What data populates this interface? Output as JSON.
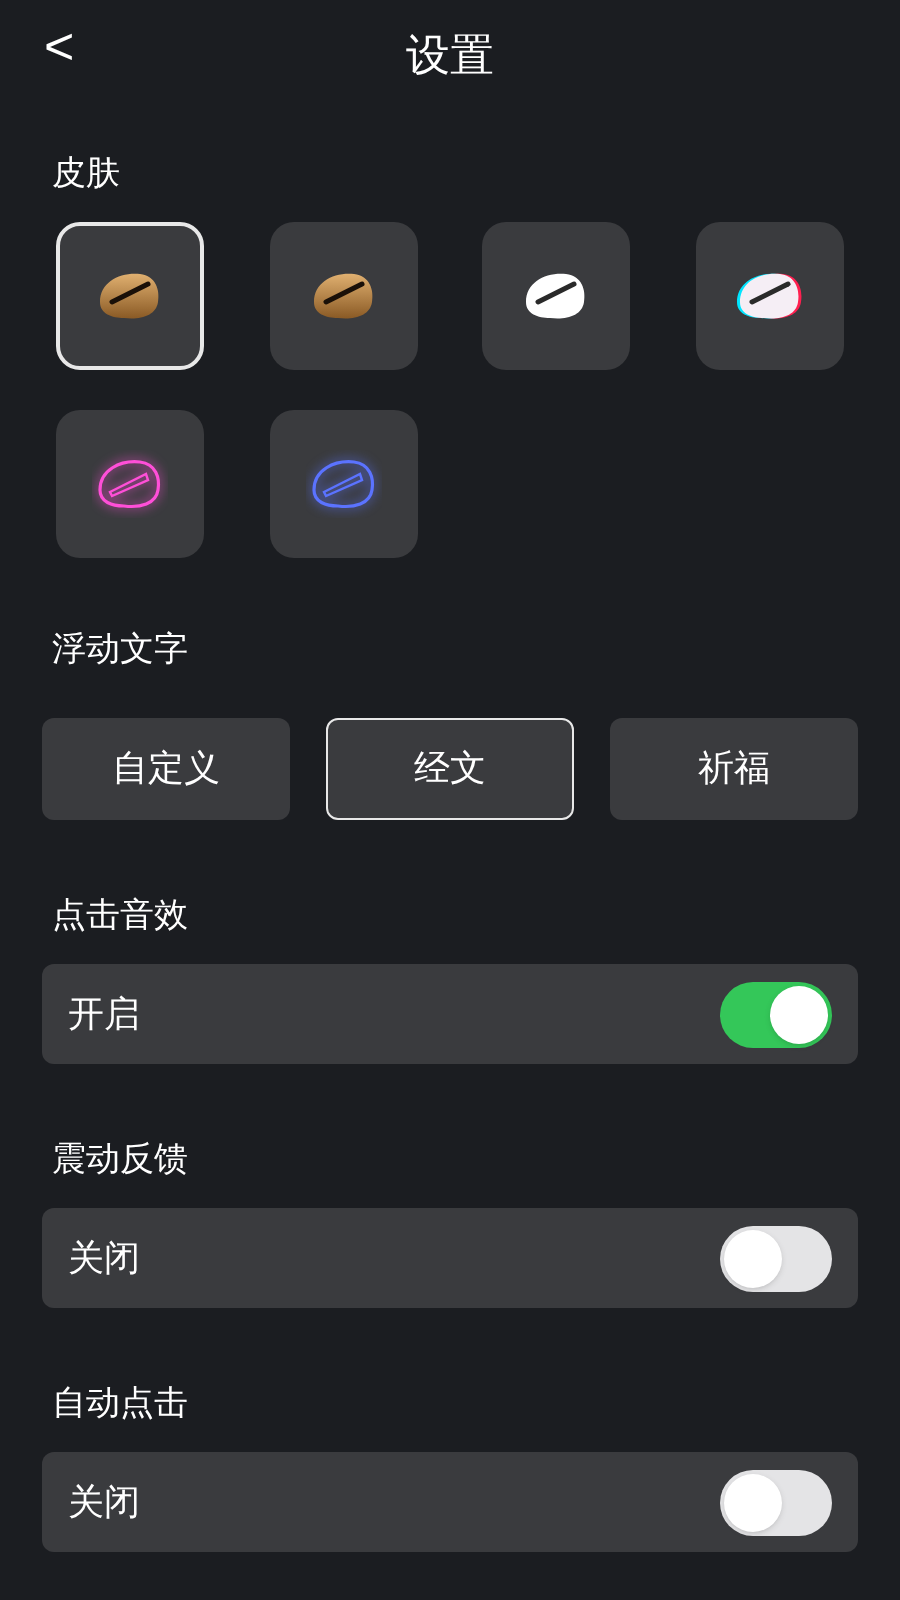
{
  "header": {
    "back": "<",
    "title": "设置"
  },
  "skins": {
    "label": "皮肤",
    "items": [
      {
        "kind": "wood",
        "selected": true
      },
      {
        "kind": "wood",
        "selected": false
      },
      {
        "kind": "white",
        "selected": false
      },
      {
        "kind": "glitch",
        "selected": false
      },
      {
        "kind": "neon",
        "color": "#ff4fd8",
        "selected": false
      },
      {
        "kind": "neon",
        "color": "#5b73ff",
        "selected": false
      }
    ]
  },
  "floating_text": {
    "label": "浮动文字",
    "options": [
      {
        "label": "自定义",
        "selected": false
      },
      {
        "label": "经文",
        "selected": true
      },
      {
        "label": "祈福",
        "selected": false
      }
    ]
  },
  "settings": [
    {
      "label": "点击音效",
      "value": "开启",
      "on": true
    },
    {
      "label": "震动反馈",
      "value": "关闭",
      "on": false
    },
    {
      "label": "自动点击",
      "value": "关闭",
      "on": false
    }
  ]
}
